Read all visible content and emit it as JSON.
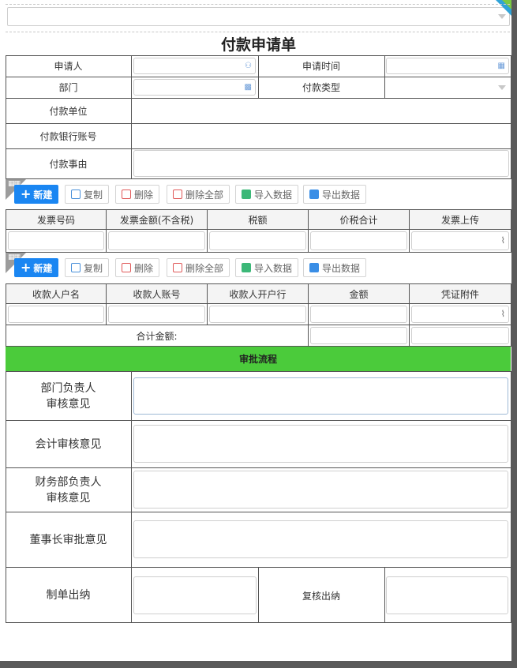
{
  "form": {
    "title": "付款申请单",
    "fields": {
      "applicant_label": "申请人",
      "apply_time_label": "申请时间",
      "department_label": "部门",
      "payment_type_label": "付款类型",
      "payee_unit_label": "付款单位",
      "bank_account_label": "付款银行账号",
      "reason_label": "付款事由"
    }
  },
  "toolbar": {
    "new_label": "新建",
    "copy_label": "复制",
    "delete_label": "删除",
    "delete_all_label": "删除全部",
    "import_label": "导入数据",
    "export_label": "导出数据"
  },
  "invoice_table": {
    "columns": [
      "发票号码",
      "发票金额(不含税)",
      "税额",
      "价税合计",
      "发票上传"
    ]
  },
  "payee_table": {
    "columns": [
      "收款人户名",
      "收款人账号",
      "收款人开户行",
      "金额",
      "凭证附件"
    ],
    "total_label": "合计金额:"
  },
  "approval": {
    "header": "审批流程",
    "dept_head_line1": "部门负责人",
    "dept_head_line2": "审核意见",
    "accounting": "会计审核意见",
    "finance_head_line1": "财务部负责人",
    "finance_head_line2": "审核意见",
    "chairman": "董事长审批意见",
    "cashier_make": "制单出纳",
    "cashier_review": "复核出纳"
  },
  "colors": {
    "primary_button": "#1a86f2",
    "approval_header": "#4bcb3b",
    "border": "#555555"
  },
  "icons": {
    "applicant": "user-icon",
    "apply_time": "calendar-icon",
    "department": "org-icon",
    "attachment": "paperclip-icon"
  }
}
